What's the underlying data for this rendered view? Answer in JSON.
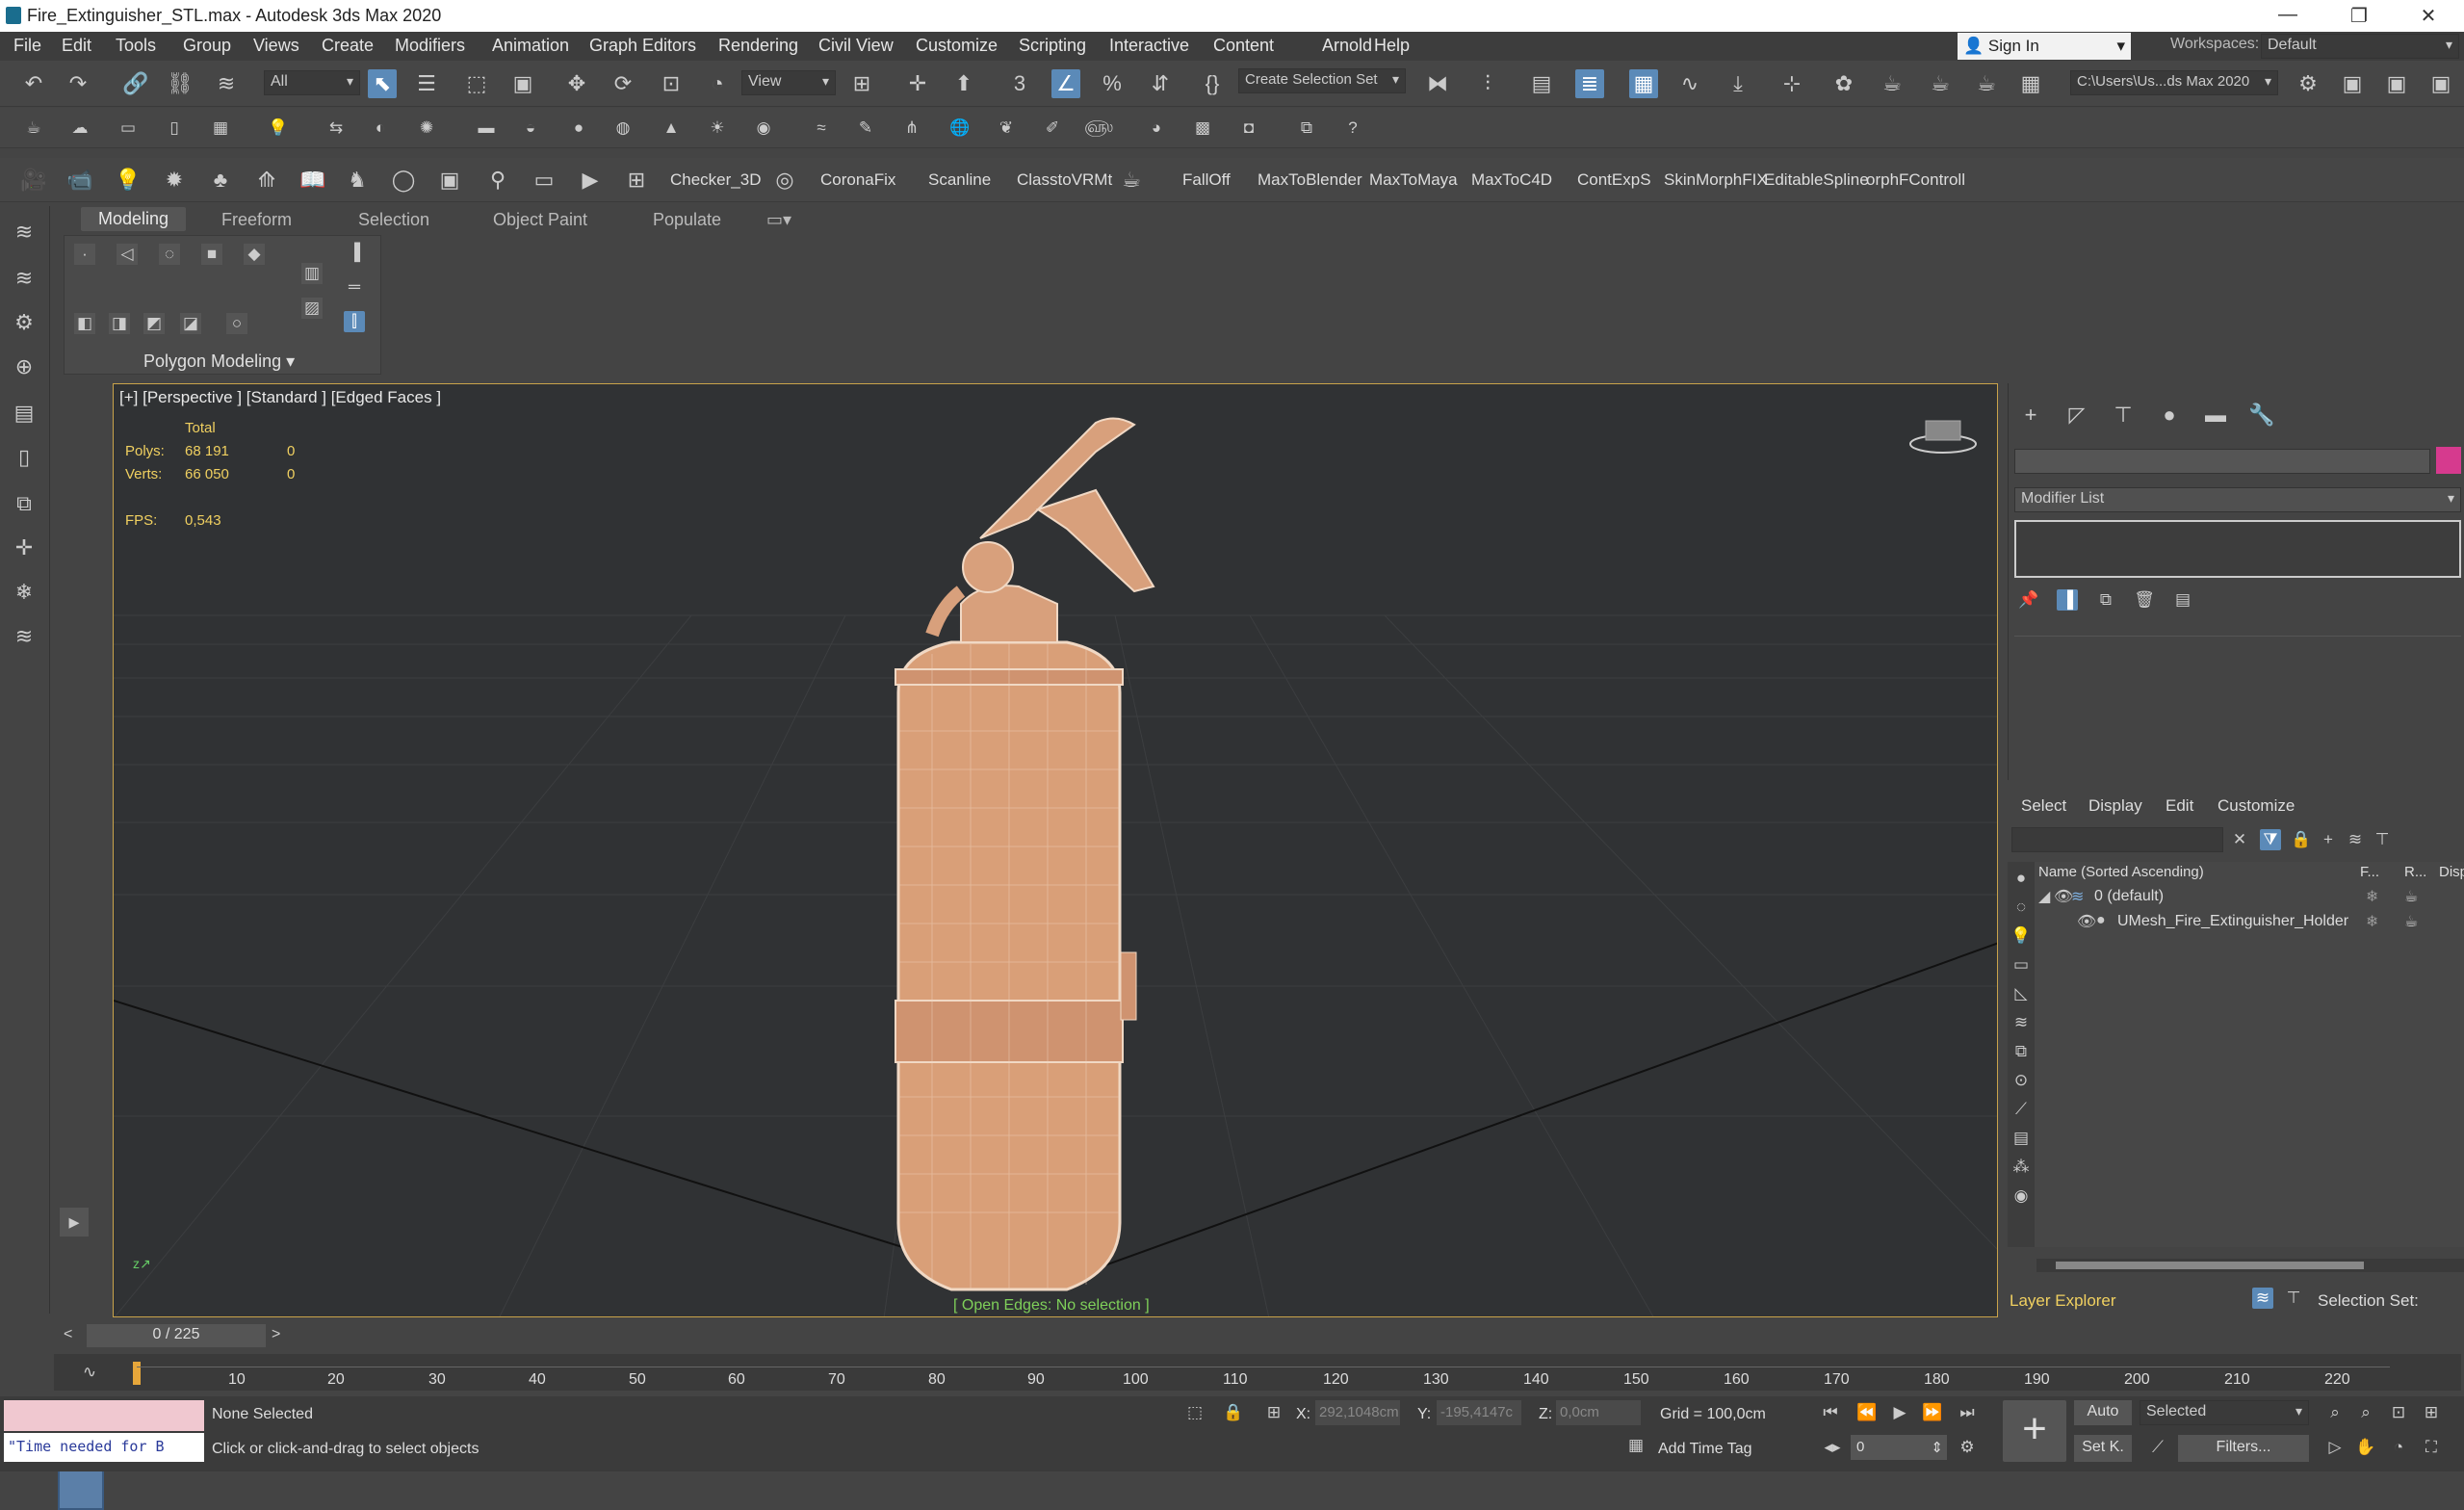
{
  "titlebar": {
    "title": "Fire_Extinguisher_STL.max - Autodesk 3ds Max 2020",
    "minimize": "—",
    "maximize": "❐",
    "close": "✕"
  },
  "menu": [
    "File",
    "Edit",
    "Tools",
    "Group",
    "Views",
    "Create",
    "Modifiers",
    "Animation",
    "Graph Editors",
    "Rendering",
    "Civil View",
    "Customize",
    "Scripting",
    "Interactive",
    "Content",
    "Arnold",
    "Help"
  ],
  "signin": {
    "label": "Sign In"
  },
  "workspaces": {
    "label": "Workspaces:",
    "value": "Default"
  },
  "toolbar": {
    "filter": "All",
    "refcoord": "View",
    "selection_set": "Create Selection Set",
    "path": "C:\\Users\\Us...ds Max 2020"
  },
  "plugins": [
    "Checker_3D",
    "CoronaFix",
    "Scanline",
    "ClasstoVRMt",
    "FallOff",
    "MaxToBlender",
    "MaxToMaya",
    "MaxToC4D",
    "ContExpS",
    "SkinMorphFIX",
    "EditableSpline",
    "orphFControll"
  ],
  "ribbon": {
    "tabs": [
      "Modeling",
      "Freeform",
      "Selection",
      "Object Paint",
      "Populate"
    ],
    "panel": "Polygon Modeling"
  },
  "viewport": {
    "label": "[+] [Perspective ] [Standard ] [Edged Faces ]",
    "total": "Total",
    "polys_label": "Polys:",
    "polys": "68 191",
    "polys_sel": "0",
    "verts_label": "Verts:",
    "verts": "66 050",
    "verts_sel": "0",
    "fps_label": "FPS:",
    "fps": "0,543",
    "open_edges": "[ Open Edges: No selection ]"
  },
  "cmdpanel": {
    "modifier_list": "Modifier List",
    "color": "#d63a8e"
  },
  "explorer": {
    "tabs": [
      "Select",
      "Display",
      "Edit",
      "Customize"
    ],
    "header_name": "Name (Sorted Ascending)",
    "header_f": "F...",
    "header_r": "R...",
    "header_d": "Displa",
    "rows": [
      "0 (default)",
      "UMesh_Fire_Extinguisher_Holder"
    ],
    "layer_explorer": "Layer Explorer",
    "selection_set": "Selection Set:"
  },
  "timeline": {
    "frame": "0 / 225",
    "ticks": [
      "10",
      "20",
      "30",
      "40",
      "50",
      "60",
      "70",
      "80",
      "90",
      "100",
      "110",
      "120",
      "130",
      "140",
      "150",
      "160",
      "170",
      "180",
      "190",
      "200",
      "210",
      "220"
    ]
  },
  "status": {
    "maxscript": "\"Time needed for B",
    "selected": "None Selected",
    "prompt": "Click or click-and-drag to select objects",
    "x_label": "X:",
    "x": "292,1048cm",
    "y_label": "Y:",
    "y": "-195,4147c",
    "z_label": "Z:",
    "z": "0,0cm",
    "grid": "Grid = 100,0cm",
    "add_time_tag": "Add Time Tag",
    "auto": "Auto",
    "setk": "Set K.",
    "key_mode": "Selected",
    "filters": "Filters...",
    "frame_field": "0"
  }
}
